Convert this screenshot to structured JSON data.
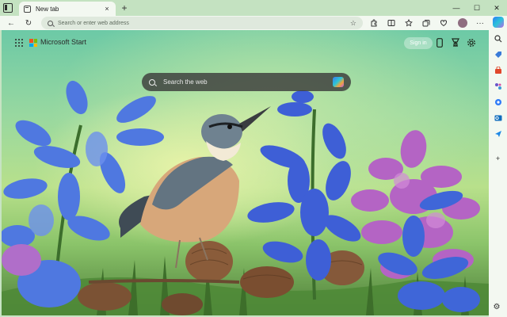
{
  "tab": {
    "title": "New tab",
    "close": "×",
    "new_tab": "+"
  },
  "window_controls": {
    "minimize": "—",
    "maximize": "☐",
    "close": "✕"
  },
  "toolbar": {
    "back": "←",
    "refresh": "↻",
    "address_placeholder": "Search or enter web address",
    "favorite_star": "☆",
    "more": "···"
  },
  "page": {
    "brand": "Microsoft Start",
    "signin_label": "Sign in",
    "search_placeholder": "Search the web"
  },
  "colors": {
    "ms_red": "#f25022",
    "ms_green": "#7fba00",
    "ms_blue": "#00a4ef",
    "ms_yellow": "#ffb900",
    "tabstrip_bg": "#c4e2c1",
    "toolbar_bg": "#f3f8f1"
  },
  "icons": {
    "toolbar": [
      "extensions-icon",
      "split-screen-icon",
      "favorites-icon",
      "collections-icon",
      "browser-essentials-icon",
      "profile-avatar",
      "more-icon",
      "copilot-icon"
    ],
    "header": [
      "phone-icon",
      "rewards-icon",
      "settings-icon"
    ],
    "sidebar": [
      "search-icon",
      "tag-icon",
      "shopping-icon",
      "games-icon",
      "copilot-sidebar-icon",
      "outlook-icon",
      "send-icon",
      "add-icon"
    ]
  },
  "sidebar_add": "+",
  "sidebar_settings": "⚙"
}
